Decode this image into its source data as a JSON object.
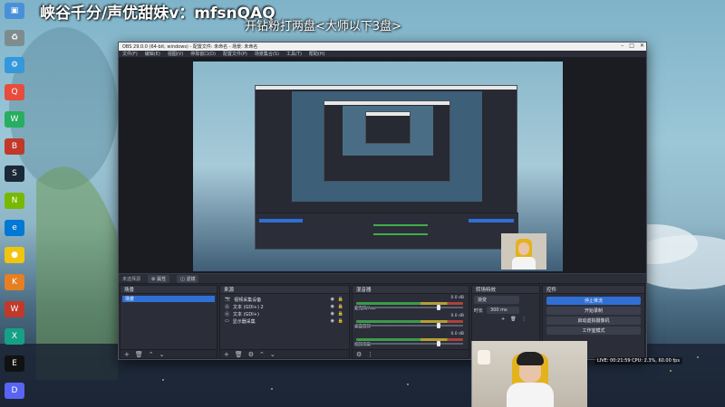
{
  "stream": {
    "title": "峡谷千分/声优甜妹v：mfsnQAQ",
    "subtitle": "开钻粉打两盘<大师以下3盘>"
  },
  "obs": {
    "window_title": "OBS 29.0.0 (64-bit, windows) - 配置文件: 未命名 - 场景: 未命名",
    "window_buttons": [
      "–",
      "□",
      "✕"
    ],
    "menu": [
      "文件(F)",
      "编辑(E)",
      "视图(V)",
      "停靠窗口(D)",
      "配置文件(P)",
      "场景集合(S)",
      "工具(T)",
      "帮助(H)"
    ],
    "toolbar": {
      "no_source": "未选择源",
      "properties": "属性",
      "filters": "滤镜"
    },
    "scenes": {
      "header": "场景",
      "items": [
        "场景"
      ]
    },
    "sources": {
      "header": "来源",
      "items": [
        {
          "icon": "camera-icon",
          "name": "视频采集设备"
        },
        {
          "icon": "text-icon",
          "name": "文本 (GDI+) 2"
        },
        {
          "icon": "text-icon",
          "name": "文本 (GDI+)"
        },
        {
          "icon": "monitor-icon",
          "name": "显示器采集"
        }
      ]
    },
    "mixer": {
      "header": "混音器",
      "channels": [
        {
          "name": "麦克风/Aux",
          "db": "0.0 dB",
          "level": 0.78
        },
        {
          "name": "桌面音频",
          "db": "0.0 dB",
          "level": 0.78
        },
        {
          "name": "视频采集",
          "db": "0.0 dB",
          "level": 0.78
        }
      ]
    },
    "transitions": {
      "header": "转场特效",
      "type": "渐变",
      "duration_label": "时长",
      "duration": "300 ms"
    },
    "controls": {
      "header": "控件",
      "buttons": [
        "停止推流",
        "开始录制",
        "启动虚拟摄像机",
        "工作室模式"
      ],
      "status": "LIVE: 00:21:59  CPU: 2.3%, 60.00 fps"
    }
  },
  "desktop": {
    "icons": [
      {
        "label": "电脑",
        "color": "#4a90d9"
      },
      {
        "label": "回收站",
        "color": "#7f8c8d"
      },
      {
        "label": "控制面板",
        "color": "#3498db"
      },
      {
        "label": "QQ",
        "color": "#e74c3c"
      },
      {
        "label": "微信",
        "color": "#27ae60"
      },
      {
        "label": "OBS",
        "color": "#2c3e50"
      },
      {
        "label": "Steam",
        "color": "#1b2838"
      },
      {
        "label": "NVIDIA",
        "color": "#76b900"
      },
      {
        "label": "Edge",
        "color": "#0078d4"
      },
      {
        "label": "Chrome",
        "color": "#f1c40f"
      },
      {
        "label": "酷狗",
        "color": "#e67e22"
      },
      {
        "label": "WPS",
        "color": "#c0392b"
      },
      {
        "label": "迅雷",
        "color": "#16a085"
      },
      {
        "label": "Epic",
        "color": "#111111"
      },
      {
        "label": "Discord",
        "color": "#5865f2"
      }
    ]
  },
  "colors": {
    "accent": "#2f6fd6",
    "panel": "#2b2e38",
    "preview": "#1a1c22"
  }
}
